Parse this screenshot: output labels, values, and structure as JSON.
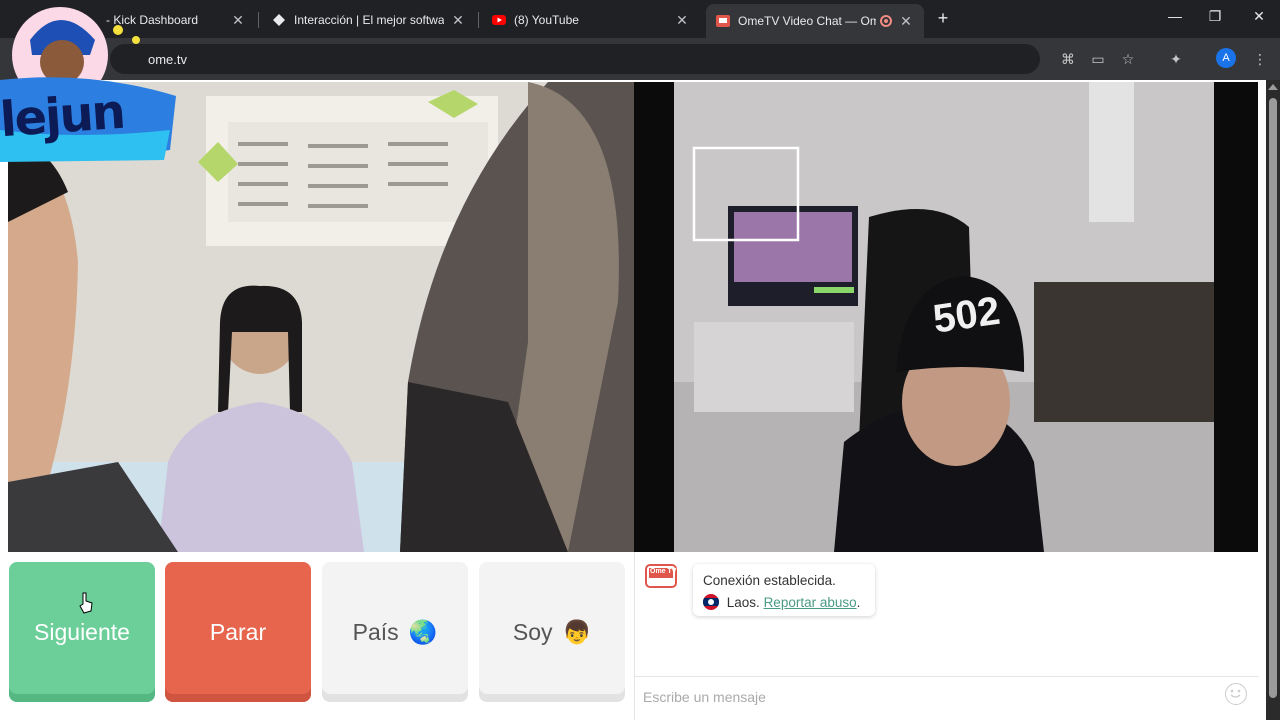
{
  "browser": {
    "tabs": [
      {
        "title": "- Kick Dashboard",
        "icon": "kick-icon"
      },
      {
        "title": "Interacción | El mejor software p",
        "icon": "diamond-icon"
      },
      {
        "title": "(8) YouTube",
        "icon": "youtube-icon"
      },
      {
        "title": "OmeTV Video Chat — Ome",
        "icon": "ometv-icon",
        "active": true
      }
    ],
    "new_tab": "+",
    "url": "ome.tv",
    "profile_initial": "A"
  },
  "controls": {
    "next_label": "Siguiente",
    "stop_label": "Parar",
    "country_label": "País",
    "country_emoji": "🌏",
    "gender_label": "Soy",
    "gender_emoji": "👦"
  },
  "chat": {
    "logo_text": "Ome TV",
    "status": "Conexión establecida.",
    "country": "Laos.",
    "report_link": "Reportar abuso",
    "report_suffix": ".",
    "input_placeholder": "Escribe un mensaje"
  },
  "overlay": {
    "logo_text": "lejun"
  },
  "colors": {
    "next": "#6ccf9a",
    "stop": "#e7644d",
    "link": "#4a9b86",
    "chrome_bg": "#202124"
  }
}
